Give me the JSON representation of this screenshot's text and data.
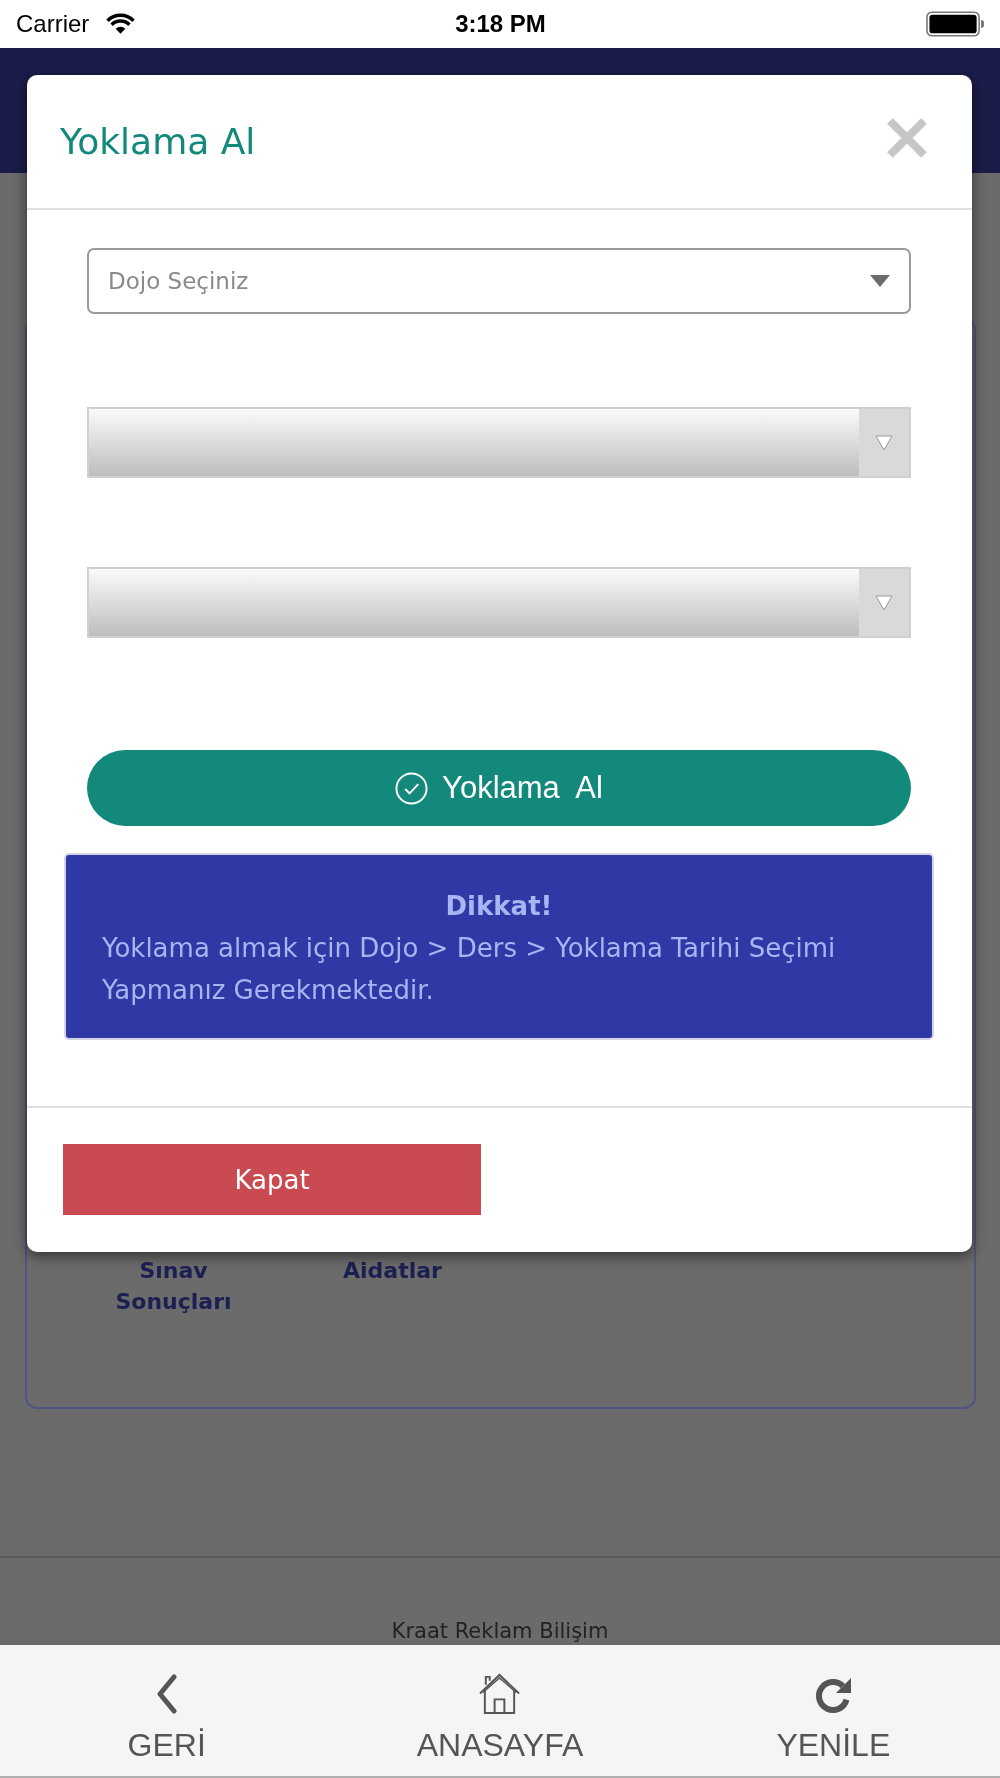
{
  "status_bar": {
    "carrier": "Carrier",
    "time": "3:18 PM"
  },
  "background": {
    "tiles": [
      {
        "label": "Sınav Sonuçları"
      },
      {
        "label": "Aidatlar"
      }
    ],
    "footer": "Kraat Reklam Bilişim"
  },
  "modal": {
    "title": "Yoklama Al",
    "selects": [
      {
        "kind": "outline",
        "placeholder": "Dojo Seçiniz"
      },
      {
        "kind": "gradient"
      },
      {
        "kind": "gradient"
      }
    ],
    "submit_button": "Yoklama  Al",
    "alert": {
      "title": "Dikkat!",
      "message": "Yoklama almak için Dojo > Ders > Yoklama Tarihi Seçimi Yapmanız Gerekmektedir."
    },
    "close_button": "Kapat"
  },
  "tab_bar": [
    {
      "kind": "back",
      "label": "GERİ"
    },
    {
      "kind": "home",
      "label": "ANASAYFA"
    },
    {
      "kind": "refresh",
      "label": "YENİLE"
    }
  ]
}
